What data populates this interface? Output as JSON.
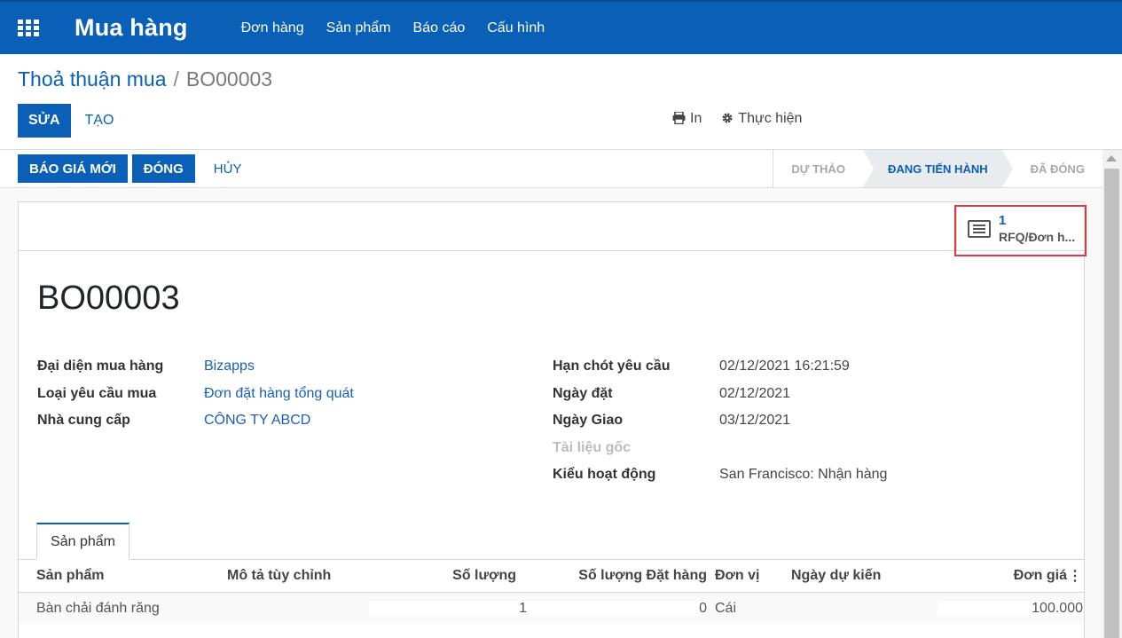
{
  "navbar": {
    "app_title": "Mua hàng",
    "menu": [
      "Đơn hàng",
      "Sản phẩm",
      "Báo cáo",
      "Cấu hình"
    ],
    "color": "#0a60b6"
  },
  "breadcrumb": {
    "parent": "Thoả thuận mua",
    "separator": "/",
    "current": "BO00003"
  },
  "control_panel": {
    "edit_label": "SỬA",
    "create_label": "TẠO",
    "print_label": "In",
    "print_icon": "print-icon",
    "action_label": "Thực hiện",
    "action_icon": "gear-icon"
  },
  "statusbar": {
    "buttons": [
      "BÁO GIÁ MỚI",
      "ĐÓNG"
    ],
    "cancel_label": "HỦY",
    "stages": [
      "DỰ THẢO",
      "ĐANG TIẾN HÀNH",
      "ĐÃ ĐÓNG"
    ],
    "active_stage": "ĐANG TIẾN HÀNH"
  },
  "smart_button": {
    "count": "1",
    "label": "RFQ/Đơn h...",
    "icon": "list-icon"
  },
  "record": {
    "title": "BO00003",
    "left_fields": [
      {
        "label": "Đại diện mua hàng",
        "value": "Bizapps"
      },
      {
        "label": "Loại yêu cầu mua",
        "value": "Đơn đặt hàng tổng quát"
      },
      {
        "label": "Nhà cung cấp",
        "value": "CÔNG TY ABCD"
      }
    ],
    "right_fields": [
      {
        "label": "Hạn chót yêu cầu",
        "value": "02/12/2021 16:21:59"
      },
      {
        "label": "Ngày đặt",
        "value": "02/12/2021"
      },
      {
        "label": "Ngày Giao",
        "value": "03/12/2021"
      },
      {
        "label": "Tài liệu gốc",
        "value": ""
      },
      {
        "label": "Kiểu hoạt động",
        "value": "San Francisco: Nhận hàng"
      }
    ]
  },
  "tabs": [
    "Sản phẩm"
  ],
  "table": {
    "headers": [
      "Sản phẩm",
      "Mô tả tùy chỉnh",
      "Số lượng",
      "Số lượng Đặt hàng",
      "Đơn vị",
      "Ngày dự kiến",
      "Đơn giá"
    ],
    "rows": [
      [
        "Bàn chải đánh răng",
        "",
        "1",
        "0",
        "Cái",
        "",
        "100.000"
      ]
    ]
  }
}
